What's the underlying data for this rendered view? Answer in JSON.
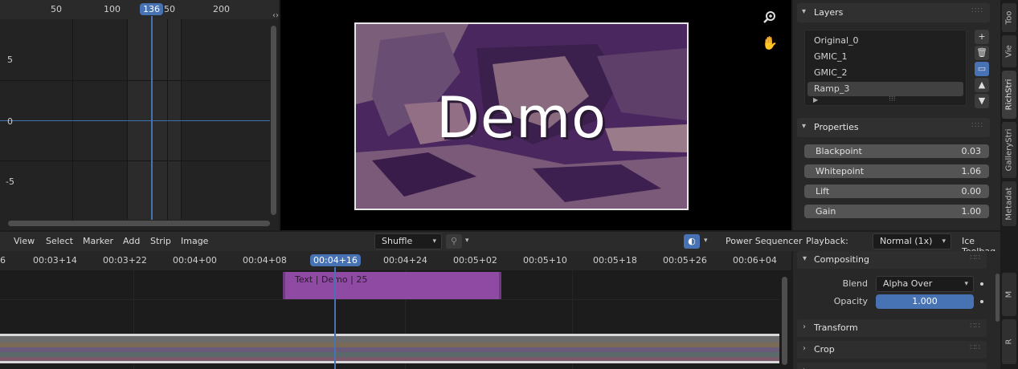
{
  "graph_editor": {
    "frame_ticks": [
      "50",
      "100",
      "50",
      "200"
    ],
    "current_frame": "136",
    "y_labels": [
      "5",
      "0",
      "-5"
    ]
  },
  "preview": {
    "overlay_text": "Demo",
    "zoom_icon": "zoom-in-icon",
    "pan_icon": "hand-icon"
  },
  "layers_panel": {
    "title": "Layers",
    "items": [
      "Original_0",
      "GMIC_1",
      "GMIC_2",
      "Ramp_3"
    ],
    "selected": "Ramp_3"
  },
  "properties_panel": {
    "title": "Properties",
    "rows": [
      {
        "label": "Blackpoint",
        "value": "0.03"
      },
      {
        "label": "Whitepoint",
        "value": "1.06"
      },
      {
        "label": "Lift",
        "value": "0.00"
      },
      {
        "label": "Gain",
        "value": "1.00"
      }
    ]
  },
  "vertical_tabs": [
    "Too",
    "Vie",
    "RichStri",
    "GalleryStri",
    "Metadat",
    "M",
    "R"
  ],
  "sequencer_header": {
    "menus": [
      "View",
      "Select",
      "Marker",
      "Add",
      "Strip",
      "Image"
    ],
    "snap_dropdown": "Shuffle",
    "power_sequencer": "Power Sequencer",
    "playback_label": "Playback:",
    "playback_value": "Normal (1x)",
    "ice_toolbag": "Ice Toolbag"
  },
  "timeline": {
    "timecodes": [
      "6",
      "00:03+14",
      "00:03+22",
      "00:04+00",
      "00:04+08",
      "00:04+16",
      "00:04+24",
      "00:05+02",
      "00:05+10",
      "00:05+18",
      "00:05+26",
      "00:06+04"
    ],
    "current_timecode": "00:04+16",
    "strip_label": "Text | Demo | 25"
  },
  "compositing": {
    "title": "Compositing",
    "blend_label": "Blend",
    "blend_value": "Alpha Over",
    "opacity_label": "Opacity",
    "opacity_value": "1.000"
  },
  "collapsed_sections": [
    "Transform",
    "Crop"
  ],
  "colors": {
    "accent": "#4772b3",
    "strip": "#8f4ba3",
    "image_tint": "#5a2d6a"
  }
}
